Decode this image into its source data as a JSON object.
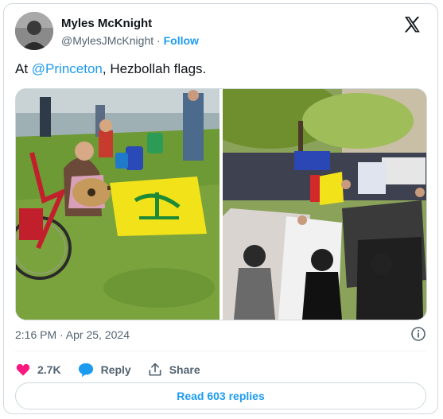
{
  "author": {
    "name": "Myles McKnight",
    "handle": "@MylesJMcKnight",
    "separator": "·",
    "follow_label": "Follow"
  },
  "tweet": {
    "prefix": "At ",
    "mention": "@Princeton",
    "suffix": ", Hezbollah flags.",
    "timestamp": "2:16 PM · Apr 25, 2024"
  },
  "media": {
    "left_photo_icon": "photo-students-on-lawn-with-yellow-flag",
    "right_photo_icon": "photo-crowd-holding-flags-and-keffiyehs"
  },
  "actions": {
    "like_count": "2.7K",
    "reply_label": "Reply",
    "share_label": "Share"
  },
  "footer": {
    "read_replies_label": "Read 603 replies"
  },
  "colors": {
    "accent": "#1d9bf0",
    "like": "#f91880",
    "muted": "#536471",
    "border": "#cfd9de"
  }
}
